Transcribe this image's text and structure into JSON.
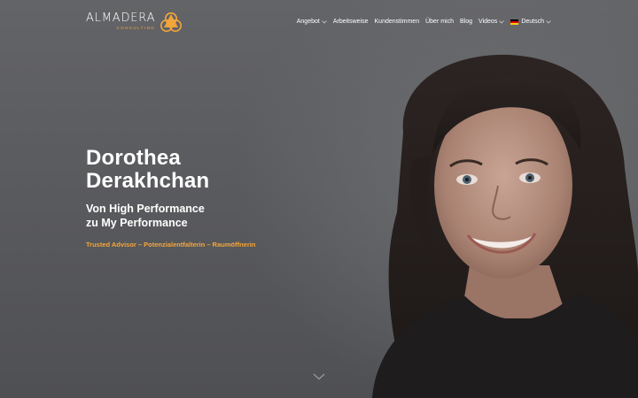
{
  "brand": {
    "name": "ALMADERA",
    "subtitle": "CONSULTING",
    "accent_color": "#f5a63a"
  },
  "nav": {
    "items": [
      {
        "label": "Angebot",
        "has_dropdown": true
      },
      {
        "label": "Arbeitsweise",
        "has_dropdown": false
      },
      {
        "label": "Kundenstimmen",
        "has_dropdown": false
      },
      {
        "label": "Über mich",
        "has_dropdown": false
      },
      {
        "label": "Blog",
        "has_dropdown": false
      },
      {
        "label": "Videos",
        "has_dropdown": true
      }
    ],
    "language": {
      "label": "Deutsch",
      "flag_icon": "german-flag-icon"
    }
  },
  "hero": {
    "first_name": "Dorothea",
    "last_name": "Derakhchan",
    "tagline_line1": "Von High Performance",
    "tagline_line2": "zu My Performance",
    "roles": "Trusted Advisor – Potenzialentfalterin – Raumöffnerin"
  },
  "icons": {
    "scroll": "chevron-down-icon",
    "logo_mark": "three-circles-logo-icon"
  }
}
